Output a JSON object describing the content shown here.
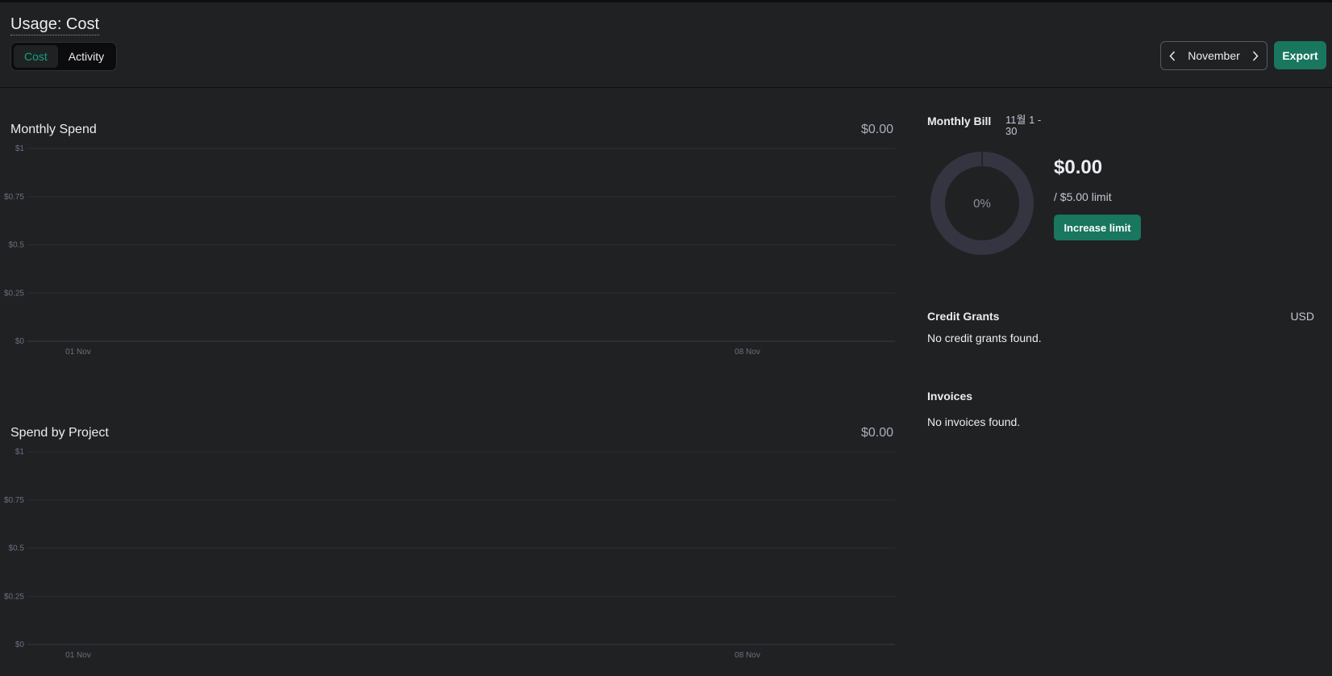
{
  "header": {
    "title": "Usage: Cost",
    "tabs": [
      {
        "label": "Cost",
        "active": true
      },
      {
        "label": "Activity",
        "active": false
      }
    ],
    "month": "November",
    "export_label": "Export"
  },
  "monthly_spend": {
    "title": "Monthly Spend",
    "total": "$0.00"
  },
  "spend_by_project": {
    "title": "Spend by Project",
    "total": "$0.00"
  },
  "chart_data": [
    {
      "type": "bar",
      "title": "Monthly Spend",
      "y_ticks": [
        "$0",
        "$0.25",
        "$0.5",
        "$0.75",
        "$1"
      ],
      "x_ticks": [
        "01 Nov",
        "08 Nov"
      ],
      "ylim": [
        0,
        1
      ],
      "series": [],
      "grid": true
    },
    {
      "type": "bar",
      "title": "Spend by Project",
      "y_ticks": [
        "$0",
        "$0.25",
        "$0.5",
        "$0.75",
        "$1"
      ],
      "x_ticks": [
        "01 Nov",
        "08 Nov"
      ],
      "ylim": [
        0,
        1
      ],
      "series": [],
      "grid": true
    }
  ],
  "monthly_bill": {
    "title": "Monthly Bill",
    "range": "11월 1 - 30",
    "percent_label": "0%",
    "usage_fraction": 0,
    "amount": "$0.00",
    "limit": "/ $5.00 limit",
    "increase_label": "Increase limit"
  },
  "credit_grants": {
    "title": "Credit Grants",
    "currency": "USD",
    "empty": "No credit grants found."
  },
  "invoices": {
    "title": "Invoices",
    "empty": "No invoices found."
  },
  "colors": {
    "background": "#202123",
    "accent": "#10a37f",
    "button": "#19765f",
    "donut_track": "#343541",
    "grid": "#2e2f33"
  },
  "icons": {
    "prev": "chevron-left-icon",
    "next": "chevron-right-icon"
  }
}
